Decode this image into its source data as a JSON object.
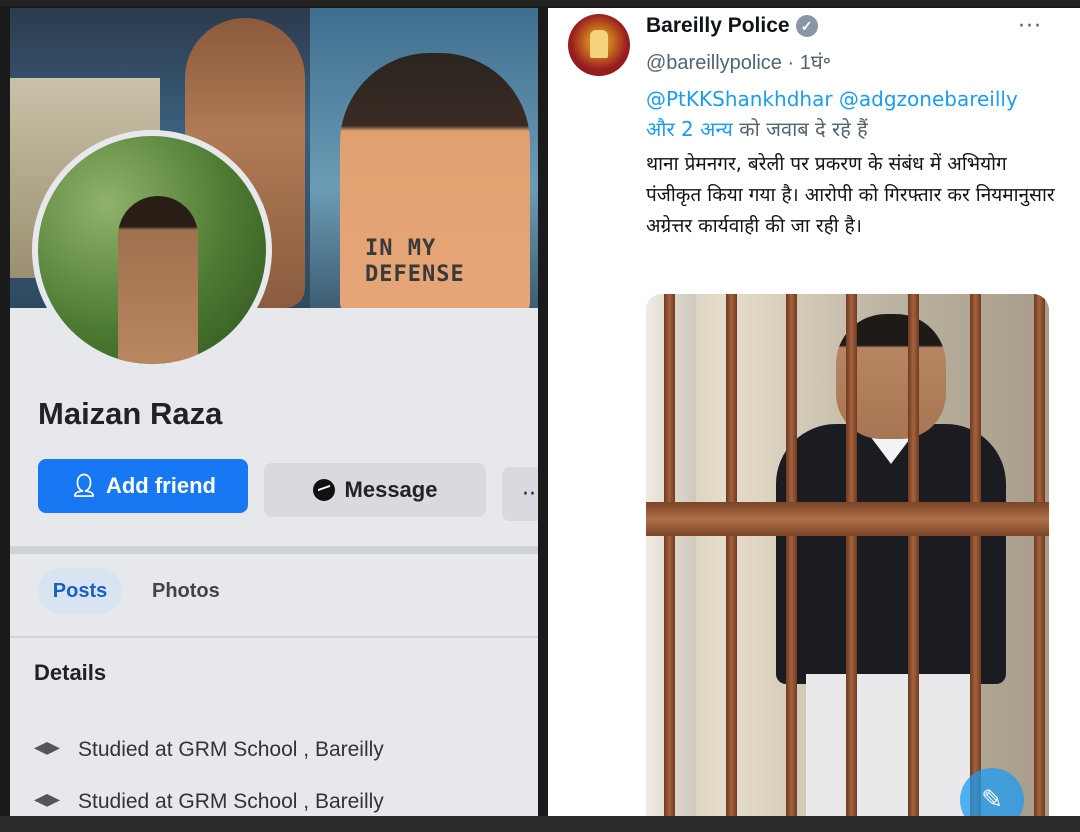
{
  "facebook": {
    "name": "Maizan Raza",
    "cover_shirt_text": "IN MY\nDEFENSE",
    "add_friend_label": "Add friend",
    "message_label": "Message",
    "more_label": "···",
    "tabs": [
      {
        "label": "Posts"
      },
      {
        "label": "Photos"
      }
    ],
    "details_heading": "Details",
    "details": [
      {
        "text": "Studied at GRM School , Bareilly"
      },
      {
        "text": "Studied at GRM School , Bareilly"
      }
    ]
  },
  "tweet": {
    "author_name": "Bareilly Police",
    "handle_time": "@bareillypolice · 1घं॰",
    "more": "···",
    "reply_links": "@PtKKShankhdhar @adgzonebareilly",
    "reply_others": "और 2 अन्य",
    "reply_suffix": " को जवाब दे रहे हैं",
    "body": "थाना प्रेमनगर, बरेली पर प्रकरण के संबंध में अभियोग पंजीकृत किया गया है। आरोपी को गिरफ्तार कर नियमानुसार अग्रेत्तर कार्यवाही की जा रही है।",
    "compose_icon": "compose-feather-icon"
  },
  "colors": {
    "fb_blue": "#1877f2",
    "twitter_link": "#1d9bf0",
    "text_primary": "#0f1419",
    "text_secondary": "#536471"
  }
}
